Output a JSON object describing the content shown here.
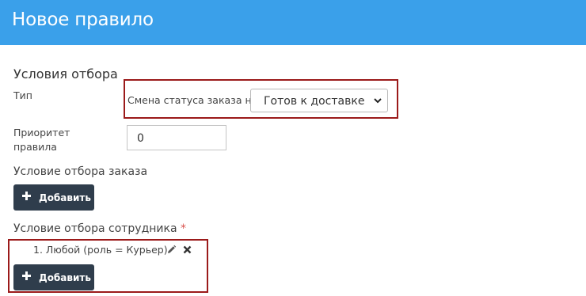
{
  "header": {
    "title": "Новое правило"
  },
  "selection_conditions": {
    "title": "Условия отбора",
    "type_label": "Тип",
    "type_prefix": "Смена статуса заказа на",
    "type_value": "Готов к доставке",
    "priority_label_line1": "Приоритет",
    "priority_label_line2": "правила",
    "priority_value": "0"
  },
  "order_condition": {
    "title": "Условие отбора заказа",
    "add_label": "Добавить"
  },
  "employee_condition": {
    "title": "Условие отбора сотрудника",
    "required_mark": "*",
    "items": [
      {
        "text": "1. Любой (роль = Курьер)"
      }
    ],
    "add_label": "Добавить"
  },
  "icons": {
    "edit": "pencil-icon",
    "remove": "close-icon",
    "add": "plus-icon",
    "dropdown": "chevron-down-icon"
  },
  "colors": {
    "header_bg": "#3aa0ea",
    "button_bg": "#2f3d4c",
    "highlight_border": "#9b1a1a",
    "required": "#d9534f"
  }
}
